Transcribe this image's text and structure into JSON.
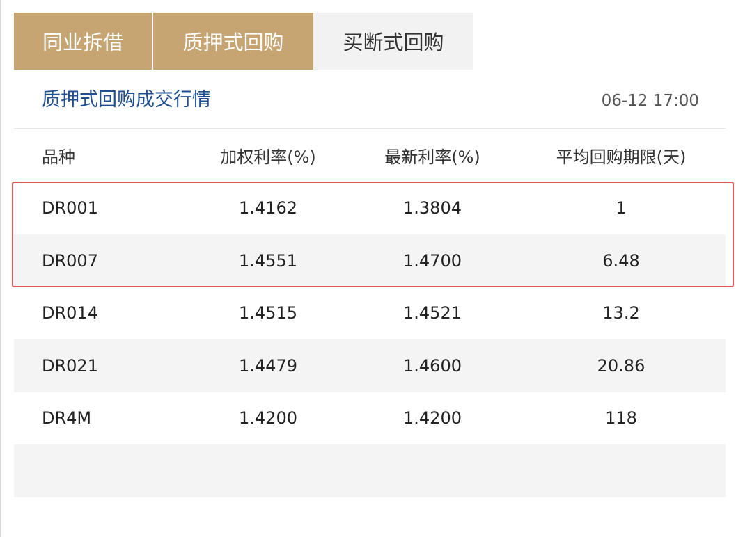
{
  "tabs": [
    {
      "label": "同业拆借",
      "active": true
    },
    {
      "label": "质押式回购",
      "active": true
    },
    {
      "label": "买断式回购",
      "active": false
    }
  ],
  "section": {
    "title": "质押式回购成交行情",
    "time": "06-12 17:00"
  },
  "table": {
    "headers": [
      "品种",
      "加权利率(%)",
      "最新利率(%)",
      "平均回购期限(天)"
    ],
    "rows": [
      [
        "DR001",
        "1.4162",
        "1.3804",
        "1"
      ],
      [
        "DR007",
        "1.4551",
        "1.4700",
        "6.48"
      ],
      [
        "DR014",
        "1.4515",
        "1.4521",
        "13.2"
      ],
      [
        "DR021",
        "1.4479",
        "1.4600",
        "20.86"
      ],
      [
        "DR4M",
        "1.4200",
        "1.4200",
        "118"
      ]
    ]
  },
  "colors": {
    "tab_active_bg": "#c6a572",
    "tab_inactive_bg": "#f2f2f2",
    "title_blue": "#1f4f8f",
    "highlight_red": "#e05a5a",
    "row_shade": "#f4f4f4"
  }
}
